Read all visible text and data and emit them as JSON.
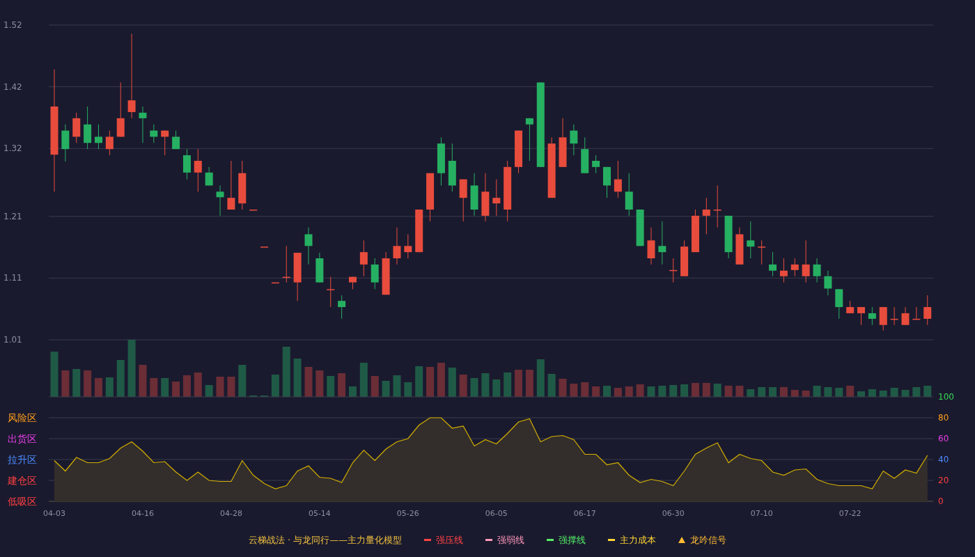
{
  "price_chart": {
    "chart_data": {
      "type": "candlestick",
      "grid": true,
      "ylim": [
        1.01,
        1.52
      ],
      "yticks": [
        1.52,
        1.42,
        1.32,
        1.21,
        1.11,
        1.01
      ],
      "categories": [
        null,
        null,
        null,
        null,
        null,
        null,
        null,
        null,
        null,
        null,
        null,
        null,
        null,
        null,
        null,
        null,
        null,
        null,
        null,
        null,
        null,
        null,
        null,
        null,
        null,
        null,
        null,
        null,
        null,
        null,
        null,
        null,
        null,
        null,
        null,
        null,
        null,
        null,
        null,
        null,
        null,
        null,
        null,
        null,
        null,
        null,
        null,
        null,
        null,
        null,
        null,
        null,
        null,
        null,
        null,
        null,
        null,
        null,
        null,
        null,
        null,
        null,
        null,
        null,
        null,
        null,
        null,
        null,
        null,
        null,
        null,
        null,
        null,
        null,
        null,
        null,
        null,
        null,
        null,
        null
      ],
      "ohlc": [
        [
          1.31,
          1.448,
          1.25,
          1.388
        ],
        [
          1.349,
          1.359,
          1.299,
          1.319
        ],
        [
          1.339,
          1.378,
          1.329,
          1.369
        ],
        [
          1.359,
          1.388,
          1.319,
          1.329
        ],
        [
          1.339,
          1.359,
          1.319,
          1.329
        ],
        [
          1.319,
          1.349,
          1.309,
          1.339
        ],
        [
          1.339,
          1.427,
          1.339,
          1.369
        ],
        [
          1.379,
          1.506,
          1.369,
          1.398
        ],
        [
          1.378,
          1.388,
          1.329,
          1.369
        ],
        [
          1.349,
          1.359,
          1.329,
          1.339
        ],
        [
          1.339,
          1.349,
          1.309,
          1.349
        ],
        [
          1.339,
          1.349,
          1.319,
          1.319
        ],
        [
          1.309,
          1.319,
          1.27,
          1.281
        ],
        [
          1.281,
          1.319,
          1.25,
          1.3
        ],
        [
          1.281,
          1.29,
          1.26,
          1.26
        ],
        [
          1.25,
          1.26,
          1.211,
          1.241
        ],
        [
          1.221,
          1.3,
          1.221,
          1.24
        ],
        [
          1.231,
          1.3,
          1.221,
          1.28
        ],
        [
          1.221,
          1.221,
          1.221,
          1.221
        ],
        [
          1.161,
          1.161,
          1.161,
          1.161
        ],
        [
          1.103,
          1.103,
          1.103,
          1.103
        ],
        [
          1.112,
          1.162,
          1.103,
          1.112
        ],
        [
          1.103,
          1.151,
          1.073,
          1.151
        ],
        [
          1.181,
          1.192,
          1.132,
          1.162
        ],
        [
          1.142,
          1.151,
          1.103,
          1.103
        ],
        [
          1.092,
          1.112,
          1.063,
          1.092
        ],
        [
          1.073,
          1.082,
          1.044,
          1.063
        ],
        [
          1.103,
          1.112,
          1.092,
          1.112
        ],
        [
          1.132,
          1.171,
          1.113,
          1.152
        ],
        [
          1.132,
          1.142,
          1.092,
          1.103
        ],
        [
          1.083,
          1.152,
          1.083,
          1.142
        ],
        [
          1.142,
          1.192,
          1.132,
          1.162
        ],
        [
          1.152,
          1.181,
          1.142,
          1.162
        ],
        [
          1.152,
          1.221,
          1.152,
          1.221
        ],
        [
          1.221,
          1.28,
          1.202,
          1.28
        ],
        [
          1.328,
          1.338,
          1.26,
          1.28
        ],
        [
          1.3,
          1.328,
          1.25,
          1.26
        ],
        [
          1.24,
          1.27,
          1.202,
          1.27
        ],
        [
          1.26,
          1.28,
          1.211,
          1.221
        ],
        [
          1.211,
          1.28,
          1.202,
          1.25
        ],
        [
          1.231,
          1.27,
          1.211,
          1.24
        ],
        [
          1.221,
          1.3,
          1.202,
          1.29
        ],
        [
          1.29,
          1.349,
          1.28,
          1.349
        ],
        [
          1.369,
          1.369,
          1.3,
          1.359
        ],
        [
          1.427,
          1.427,
          1.29,
          1.29
        ],
        [
          1.24,
          1.338,
          1.24,
          1.328
        ],
        [
          1.29,
          1.369,
          1.29,
          1.338
        ],
        [
          1.349,
          1.359,
          1.309,
          1.328
        ],
        [
          1.319,
          1.338,
          1.28,
          1.28
        ],
        [
          1.3,
          1.309,
          1.28,
          1.29
        ],
        [
          1.29,
          1.29,
          1.24,
          1.26
        ],
        [
          1.25,
          1.3,
          1.24,
          1.27
        ],
        [
          1.25,
          1.28,
          1.211,
          1.221
        ],
        [
          1.221,
          1.221,
          1.162,
          1.162
        ],
        [
          1.142,
          1.192,
          1.132,
          1.171
        ],
        [
          1.162,
          1.202,
          1.132,
          1.152
        ],
        [
          1.123,
          1.142,
          1.103,
          1.123
        ],
        [
          1.113,
          1.171,
          1.113,
          1.161
        ],
        [
          1.152,
          1.221,
          1.152,
          1.211
        ],
        [
          1.211,
          1.24,
          1.181,
          1.221
        ],
        [
          1.221,
          1.26,
          1.192,
          1.221
        ],
        [
          1.211,
          1.211,
          1.142,
          1.152
        ],
        [
          1.132,
          1.192,
          1.132,
          1.181
        ],
        [
          1.171,
          1.202,
          1.142,
          1.161
        ],
        [
          1.161,
          1.171,
          1.132,
          1.161
        ],
        [
          1.132,
          1.152,
          1.113,
          1.122
        ],
        [
          1.113,
          1.142,
          1.103,
          1.122
        ],
        [
          1.123,
          1.142,
          1.113,
          1.132
        ],
        [
          1.113,
          1.171,
          1.103,
          1.132
        ],
        [
          1.132,
          1.142,
          1.103,
          1.113
        ],
        [
          1.113,
          1.122,
          1.082,
          1.093
        ],
        [
          1.092,
          1.092,
          1.044,
          1.063
        ],
        [
          1.053,
          1.073,
          1.053,
          1.063
        ],
        [
          1.053,
          1.063,
          1.034,
          1.063
        ],
        [
          1.053,
          1.063,
          1.034,
          1.044
        ],
        [
          1.034,
          1.063,
          1.025,
          1.063
        ],
        [
          1.044,
          1.063,
          1.034,
          1.044
        ],
        [
          1.034,
          1.063,
          1.034,
          1.053
        ],
        [
          1.044,
          1.063,
          1.044,
          1.044
        ],
        [
          1.044,
          1.082,
          1.034,
          1.063
        ]
      ]
    }
  },
  "indicator": {
    "zones": [
      {
        "label": "风险区",
        "color": "#ff9f1a"
      },
      {
        "label": "出货区",
        "color": "#e83ee8"
      },
      {
        "label": "拉升区",
        "color": "#4a8cff"
      },
      {
        "label": "建仓区",
        "color": "#ff4040"
      },
      {
        "label": "低吸区",
        "color": "#ff4040"
      }
    ],
    "chart_data": {
      "type": "area",
      "grid": true,
      "ylim": [
        0,
        100
      ],
      "yticks": [
        0,
        20,
        40,
        60,
        80,
        100
      ],
      "categories": [
        "04-03",
        null,
        null,
        null,
        null,
        null,
        null,
        null,
        "04-16",
        null,
        null,
        null,
        null,
        null,
        null,
        null,
        "04-28",
        null,
        null,
        null,
        null,
        null,
        null,
        null,
        "05-14",
        null,
        null,
        null,
        null,
        null,
        null,
        null,
        "05-26",
        null,
        null,
        null,
        null,
        null,
        null,
        null,
        "06-05",
        null,
        null,
        null,
        null,
        null,
        null,
        null,
        "06-17",
        null,
        null,
        null,
        null,
        null,
        null,
        null,
        "06-30",
        null,
        null,
        null,
        null,
        null,
        null,
        null,
        "07-10",
        null,
        null,
        null,
        null,
        null,
        null,
        null,
        "07-22",
        null,
        null,
        null,
        null,
        null,
        null,
        null
      ],
      "series": [
        {
          "color": "#d4b000",
          "values": [
            39,
            29,
            42,
            37,
            37,
            41,
            51,
            57,
            48,
            37,
            38,
            28,
            20,
            28,
            20,
            19,
            19,
            39,
            25,
            17,
            12,
            15,
            29,
            34,
            23,
            22,
            18,
            37,
            49,
            39,
            50,
            57,
            60,
            73,
            80,
            80,
            70,
            72,
            53,
            59,
            55,
            65,
            76,
            79,
            57,
            62,
            63,
            59,
            45,
            45,
            35,
            37,
            25,
            18,
            21,
            19,
            15,
            29,
            45,
            51,
            56,
            37,
            45,
            41,
            39,
            28,
            25,
            30,
            31,
            21,
            17,
            15,
            15,
            15,
            12,
            29,
            22,
            30,
            27,
            44
          ]
        }
      ]
    }
  },
  "legend": {
    "title": "云梯战法 · 与龙同行——主力量化模型",
    "items": [
      {
        "kind": "solid",
        "label": "强压线",
        "color": "#ff4444"
      },
      {
        "kind": "dashed",
        "label": "强弱线",
        "color": "#ff99bb"
      },
      {
        "kind": "solid",
        "label": "强撑线",
        "color": "#55ee66"
      },
      {
        "kind": "dashed",
        "label": "主力成本",
        "color": "#ffd633"
      },
      {
        "kind": "triangle",
        "label": "龙吟信号",
        "color": "#ffbb33"
      }
    ]
  }
}
